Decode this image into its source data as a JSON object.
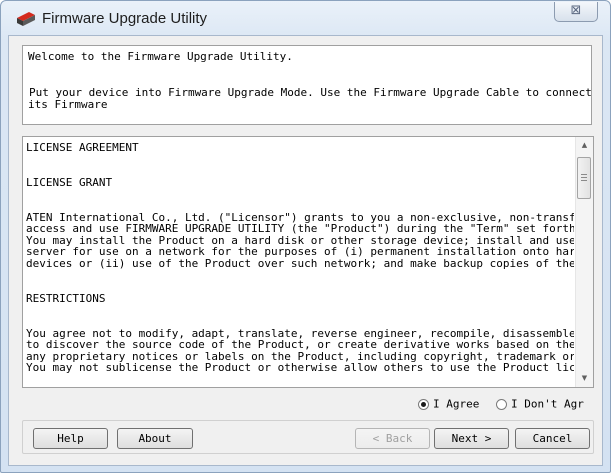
{
  "window": {
    "title": "Firmware Upgrade Utility",
    "close_symbol": "⊠"
  },
  "intro": {
    "line1": "Welcome to the Firmware Upgrade Utility.",
    "line2": "Put your device into Firmware Upgrade Mode. Use the Firmware Upgrade Cable to connect",
    "line3": "its Firmware"
  },
  "license": {
    "heading": "LICENSE AGREEMENT",
    "grant_heading": "LICENSE GRANT",
    "grant_lines": [
      "ATEN International Co., Ltd. (\"Licensor\") grants to you a non-exclusive, non-transf",
      "access and use FIRMWARE UPGRADE UTILITY (the \"Product\") during the \"Term\" set forth",
      "You may install the Product on a hard disk or other storage device; install and use",
      "server for use on a network for the purposes of (i) permanent installation onto har",
      "devices or (ii) use of the Product over such network; and make backup copies of the"
    ],
    "restrictions_heading": "RESTRICTIONS",
    "restriction_lines": [
      "You agree not to modify, adapt, translate, reverse engineer, recompile, disassemble",
      "to discover the source code of the Product, or create derivative works based on the",
      "any proprietary notices or labels on the Product, including copyright, trademark or",
      "You may not sublicense the Product or otherwise allow others to use the Product lic"
    ]
  },
  "agreement": {
    "agree_label": "I Agree",
    "disagree_label": "I Don't Agr",
    "selected": "agree"
  },
  "buttons": {
    "help": "Help",
    "about": "About",
    "back": "< Back",
    "next": "Next >",
    "cancel": "Cancel"
  },
  "colors": {
    "icon_red": "#d42a1e",
    "icon_gray": "#3a3a3a"
  }
}
